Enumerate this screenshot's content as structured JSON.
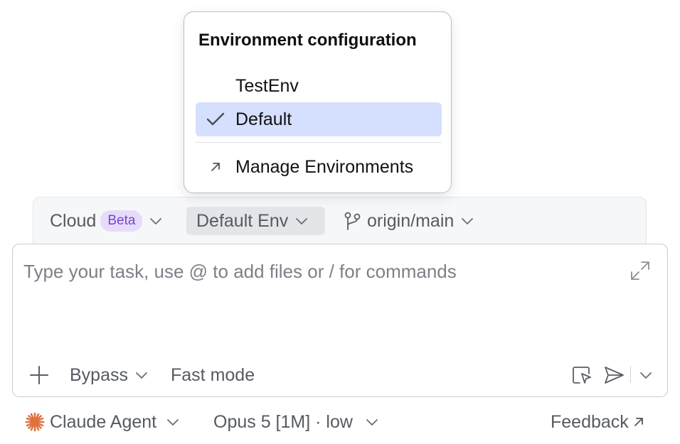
{
  "popup": {
    "title": "Environment configuration",
    "items": [
      {
        "label": "TestEnv",
        "selected": false
      },
      {
        "label": "Default",
        "selected": true
      }
    ],
    "manage_label": "Manage Environments"
  },
  "header": {
    "cloud_label": "Cloud",
    "beta_badge": "Beta",
    "env_label": "Default Env",
    "branch_label": "origin/main"
  },
  "input": {
    "placeholder": "Type your task, use @ to add files or / for commands"
  },
  "toolbar": {
    "bypass_label": "Bypass",
    "fast_mode_label": "Fast mode"
  },
  "footer": {
    "agent_label": "Claude Agent",
    "model_label": "Opus 5 [1M] · low",
    "feedback_label": "Feedback"
  },
  "colors": {
    "selection": "#d4e0fd",
    "beta_bg": "#e6dcfa",
    "beta_text": "#7a44c9",
    "agent_icon": "#e0703f"
  }
}
